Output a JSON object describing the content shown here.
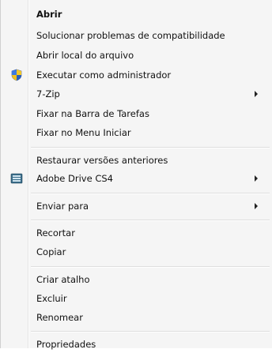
{
  "menu": {
    "items": [
      {
        "label": "Abrir"
      },
      {
        "label": "Solucionar problemas de compatibilidade"
      },
      {
        "label": "Abrir local do arquivo"
      },
      {
        "label": "Executar como administrador",
        "icon": "uac-shield-icon"
      },
      {
        "label": "7-Zip"
      },
      {
        "label": "Fixar na Barra de Tarefas"
      },
      {
        "label": "Fixar no Menu Iniciar"
      },
      {
        "label": "Restaurar versões anteriores"
      },
      {
        "label": "Adobe Drive CS4",
        "icon": "adobe-drive-icon"
      },
      {
        "label": "Enviar para"
      },
      {
        "label": "Recortar"
      },
      {
        "label": "Copiar"
      },
      {
        "label": "Criar atalho"
      },
      {
        "label": "Excluir"
      },
      {
        "label": "Renomear"
      },
      {
        "label": "Propriedades"
      }
    ]
  }
}
